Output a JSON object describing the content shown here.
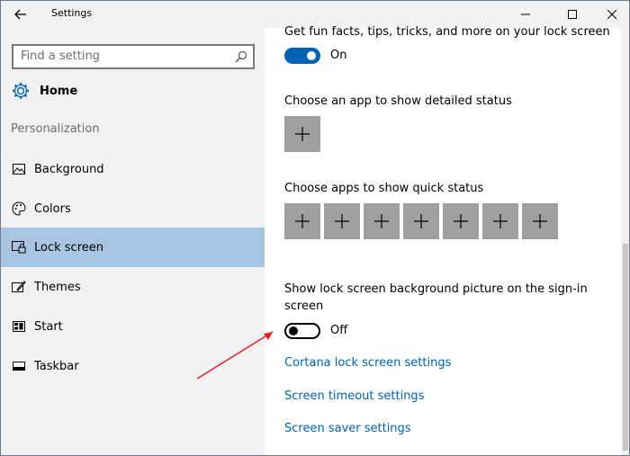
{
  "window": {
    "title": "Settings"
  },
  "sidebar": {
    "search_placeholder": "Find a setting",
    "home_label": "Home",
    "section_label": "Personalization",
    "items": [
      {
        "label": "Background",
        "icon": "image-icon"
      },
      {
        "label": "Colors",
        "icon": "palette-icon"
      },
      {
        "label": "Lock screen",
        "icon": "lock-screen-icon",
        "selected": true
      },
      {
        "label": "Themes",
        "icon": "themes-icon"
      },
      {
        "label": "Start",
        "icon": "start-icon"
      },
      {
        "label": "Taskbar",
        "icon": "taskbar-icon"
      }
    ]
  },
  "content": {
    "fun_facts_label": "Get fun facts, tips, tricks, and more on your lock screen",
    "fun_facts_state": "On",
    "detailed_status_label": "Choose an app to show detailed status",
    "quick_status_label": "Choose apps to show quick status",
    "signin_label_line1": "Show lock screen background picture on the sign-in",
    "signin_label_line2": "screen",
    "signin_state": "Off",
    "links": [
      "Cortana lock screen settings",
      "Screen timeout settings",
      "Screen saver settings"
    ]
  },
  "colors": {
    "accent": "#0063b1",
    "selected_bg": "#a7c4e0",
    "tile": "#a0a0a0",
    "annotation_arrow": "#e02020"
  }
}
